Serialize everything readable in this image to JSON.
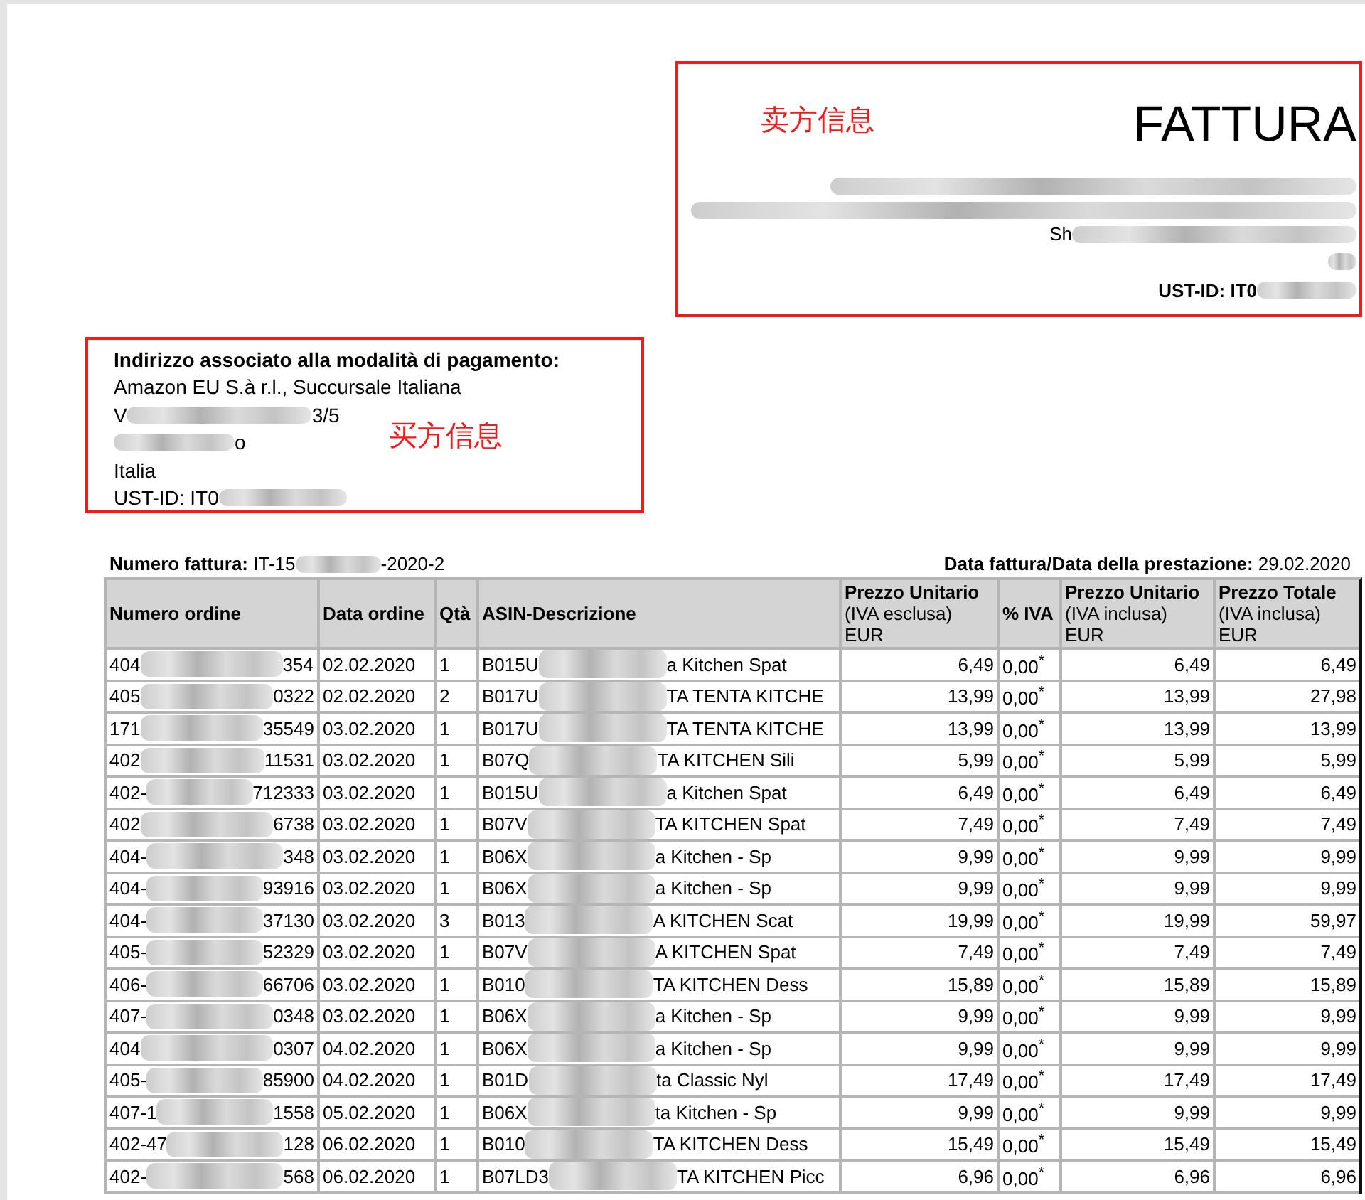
{
  "seller": {
    "note": "卖方信息",
    "title": "FATTURA",
    "city_prefix": "Sh",
    "vat_label": "UST-ID: IT0"
  },
  "buyer": {
    "heading": "Indirizzo associato alla modalità di pagamento:",
    "name": "Amazon EU S.à r.l., Succursale Italiana",
    "street_prefix": "V",
    "street_suffix": "3/5",
    "city_suffix": "o",
    "country": "Italia",
    "vat_label": "UST-ID: IT0",
    "note": "买方信息"
  },
  "invoice": {
    "number_label": "Numero fattura:",
    "number_prefix": "IT-15",
    "number_suffix": "-2020-2",
    "date_label": "Data fattura/Data della prestazione:",
    "date": "29.02.2020"
  },
  "table": {
    "columns": [
      {
        "title": "Numero ordine"
      },
      {
        "title": "Data ordine"
      },
      {
        "title": "Qtà"
      },
      {
        "title": "ASIN-Descrizione"
      },
      {
        "title": "Prezzo Unitario",
        "sub": "(IVA esclusa)",
        "unit": "EUR"
      },
      {
        "title": "% IVA"
      },
      {
        "title": "Prezzo Unitario",
        "sub": "(IVA inclusa)",
        "unit": "EUR"
      },
      {
        "title": "Prezzo Totale",
        "sub": "(IVA inclusa)",
        "unit": "EUR"
      }
    ],
    "rows": [
      {
        "order_prefix": "404",
        "order_suffix": "354",
        "date": "02.02.2020",
        "qty": "1",
        "asin_prefix": "B015U",
        "desc_suffix": "a Kitchen Spat",
        "unit_excl": "6,49",
        "vat": "0,00$^{*}$",
        "unit_incl": "6,49",
        "total": "6,49"
      },
      {
        "order_prefix": "405",
        "order_suffix": "0322",
        "date": "02.02.2020",
        "qty": "2",
        "asin_prefix": "B017U",
        "desc_suffix": "TA TENTA KITCHE",
        "unit_excl": "13,99",
        "vat": "0,00$^{*}$",
        "unit_incl": "13,99",
        "total": "27,98"
      },
      {
        "order_prefix": "171",
        "order_suffix": "35549",
        "date": "03.02.2020",
        "qty": "1",
        "asin_prefix": "B017U",
        "desc_suffix": "TA TENTA KITCHE",
        "unit_excl": "13,99",
        "vat": "0,00$^{*}$",
        "unit_incl": "13,99",
        "total": "13,99"
      },
      {
        "order_prefix": "402",
        "order_suffix": "11531",
        "date": "03.02.2020",
        "qty": "1",
        "asin_prefix": "B07Q",
        "desc_suffix": "TA KITCHEN Sili",
        "unit_excl": "5,99",
        "vat": "0,00$^{*}$",
        "unit_incl": "5,99",
        "total": "5,99"
      },
      {
        "order_prefix": "402-",
        "order_suffix": "712333",
        "date": "03.02.2020",
        "qty": "1",
        "asin_prefix": "B015U",
        "desc_suffix": "a Kitchen Spat",
        "unit_excl": "6,49",
        "vat": "0,00$^{*}$",
        "unit_incl": "6,49",
        "total": "6,49"
      },
      {
        "order_prefix": "402",
        "order_suffix": "6738",
        "date": "03.02.2020",
        "qty": "1",
        "asin_prefix": "B07V",
        "desc_suffix": "TA KITCHEN Spat",
        "unit_excl": "7,49",
        "vat": "0,00$^{*}$",
        "unit_incl": "7,49",
        "total": "7,49"
      },
      {
        "order_prefix": "404-",
        "order_suffix": "348",
        "date": "03.02.2020",
        "qty": "1",
        "asin_prefix": "B06X",
        "desc_suffix": "a Kitchen - Sp",
        "unit_excl": "9,99",
        "vat": "0,00$^{*}$",
        "unit_incl": "9,99",
        "total": "9,99"
      },
      {
        "order_prefix": "404-",
        "order_suffix": "93916",
        "date": "03.02.2020",
        "qty": "1",
        "asin_prefix": "B06X",
        "desc_suffix": "a Kitchen - Sp",
        "unit_excl": "9,99",
        "vat": "0,00$^{*}$",
        "unit_incl": "9,99",
        "total": "9,99"
      },
      {
        "order_prefix": "404-",
        "order_suffix": "37130",
        "date": "03.02.2020",
        "qty": "3",
        "asin_prefix": "B013",
        "desc_suffix": "A KITCHEN Scat",
        "unit_excl": "19,99",
        "vat": "0,00$^{*}$",
        "unit_incl": "19,99",
        "total": "59,97"
      },
      {
        "order_prefix": "405-",
        "order_suffix": "52329",
        "date": "03.02.2020",
        "qty": "1",
        "asin_prefix": "B07V",
        "desc_suffix": "A KITCHEN Spat",
        "unit_excl": "7,49",
        "vat": "0,00$^{*}$",
        "unit_incl": "7,49",
        "total": "7,49"
      },
      {
        "order_prefix": "406-",
        "order_suffix": "66706",
        "date": "03.02.2020",
        "qty": "1",
        "asin_prefix": "B010",
        "desc_suffix": "TA KITCHEN Dess",
        "unit_excl": "15,89",
        "vat": "0,00$^{*}$",
        "unit_incl": "15,89",
        "total": "15,89"
      },
      {
        "order_prefix": "407-",
        "order_suffix": "0348",
        "date": "03.02.2020",
        "qty": "1",
        "asin_prefix": "B06X",
        "desc_suffix": "a Kitchen - Sp",
        "unit_excl": "9,99",
        "vat": "0,00$^{*}$",
        "unit_incl": "9,99",
        "total": "9,99"
      },
      {
        "order_prefix": "404",
        "order_suffix": "0307",
        "date": "04.02.2020",
        "qty": "1",
        "asin_prefix": "B06X",
        "desc_suffix": "a Kitchen - Sp",
        "unit_excl": "9,99",
        "vat": "0,00$^{*}$",
        "unit_incl": "9,99",
        "total": "9,99"
      },
      {
        "order_prefix": "405-",
        "order_suffix": "85900",
        "date": "04.02.2020",
        "qty": "1",
        "asin_prefix": "B01D",
        "desc_suffix": "ta Classic Nyl",
        "unit_excl": "17,49",
        "vat": "0,00$^{*}$",
        "unit_incl": "17,49",
        "total": "17,49"
      },
      {
        "order_prefix": "407-1",
        "order_suffix": "1558",
        "date": "05.02.2020",
        "qty": "1",
        "asin_prefix": "B06X",
        "desc_suffix": "ta Kitchen - Sp",
        "unit_excl": "9,99",
        "vat": "0,00$^{*}$",
        "unit_incl": "9,99",
        "total": "9,99"
      },
      {
        "order_prefix": "402-47",
        "order_suffix": "128",
        "date": "06.02.2020",
        "qty": "1",
        "asin_prefix": "B010",
        "desc_suffix": "TA KITCHEN Dess",
        "unit_excl": "15,49",
        "vat": "0,00$^{*}$",
        "unit_incl": "15,49",
        "total": "15,49"
      },
      {
        "order_prefix": "402-",
        "order_suffix": "568",
        "date": "06.02.2020",
        "qty": "1",
        "asin_prefix": "B07LD3",
        "desc_suffix": "TA KITCHEN Picc",
        "unit_excl": "6,96",
        "vat": "0,00$^{*}$",
        "unit_incl": "6,96",
        "total": "6,96"
      }
    ]
  }
}
